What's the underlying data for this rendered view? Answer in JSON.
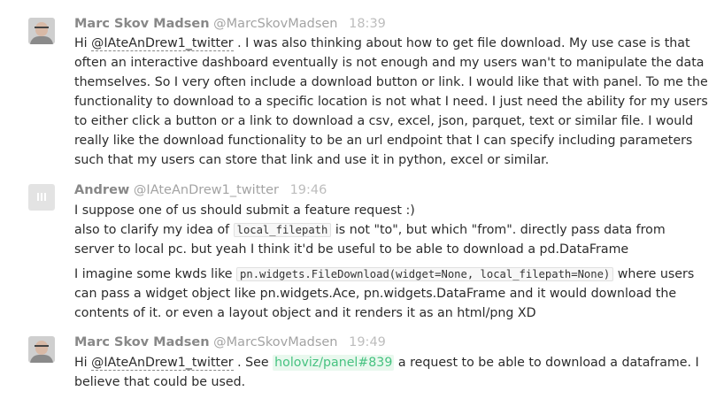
{
  "messages": [
    {
      "author": "Marc Skov Madsen",
      "handle": "@MarcSkovMadsen",
      "time": "18:39",
      "avatar_icon": "user-photo",
      "paragraphs": [
        {
          "segments": [
            {
              "type": "text",
              "text": "Hi "
            },
            {
              "type": "mention",
              "text": "@IAteAnDrew1_twitter"
            },
            {
              "type": "text",
              "text": " . I was also thinking about how to get file download. My use case is that often an interactive dashboard eventually is not enough and my users wan't to manipulate the data themselves. So I very often include a download button or link. I would like that with panel. To me the functionality to download to a specific location is not what I need. I just need the ability for my users to either click a button or a link to download a csv, excel, json, parquet, text or similar file. I would really like the download functionality to be an url endpoint that I can specify including parameters such that my users can store that link and use it in python, excel or similar."
            }
          ]
        }
      ]
    },
    {
      "author": "Andrew",
      "handle": "@IAteAnDrew1_twitter",
      "time": "19:46",
      "avatar_icon": "identicon",
      "paragraphs": [
        {
          "segments": [
            {
              "type": "text",
              "text": "I suppose one of us should submit a feature request :)"
            },
            {
              "type": "br"
            },
            {
              "type": "text",
              "text": "also to clarify my idea of "
            },
            {
              "type": "code",
              "text": "local_filepath"
            },
            {
              "type": "text",
              "text": " is not \"to\", but which \"from\". directly pass data from server to local pc. but yeah I think it'd be useful to be able to download a pd.DataFrame"
            }
          ]
        },
        {
          "segments": [
            {
              "type": "text",
              "text": "I imagine some kwds like "
            },
            {
              "type": "code",
              "text": "pn.widgets.FileDownload(widget=None, local_filepath=None)"
            },
            {
              "type": "text",
              "text": " where users can pass a widget object like pn.widgets.Ace, pn.widgets.DataFrame and it would download the contents of it. or even a layout object and it renders it as an html/png XD"
            }
          ]
        }
      ]
    },
    {
      "author": "Marc Skov Madsen",
      "handle": "@MarcSkovMadsen",
      "time": "19:49",
      "avatar_icon": "user-photo",
      "paragraphs": [
        {
          "segments": [
            {
              "type": "text",
              "text": "Hi "
            },
            {
              "type": "mention",
              "text": "@IAteAnDrew1_twitter"
            },
            {
              "type": "text",
              "text": " . See "
            },
            {
              "type": "issue",
              "text": "holoviz/panel#839"
            },
            {
              "type": "text",
              "text": " a request to be able to download a dataframe. I believe that could be used."
            }
          ]
        }
      ]
    }
  ]
}
